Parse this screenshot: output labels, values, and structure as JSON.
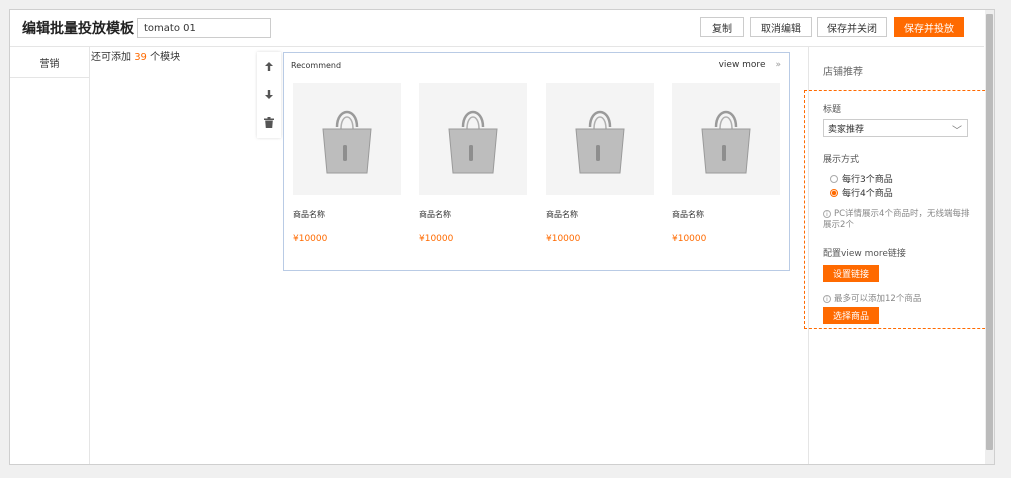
{
  "header": {
    "title": "编辑批量投放模板",
    "name_value": "tomato 01",
    "buttons": {
      "copy": "复制",
      "cancel": "取消编辑",
      "save_close": "保存并关闭",
      "save_publish": "保存并投放"
    }
  },
  "sidebar": {
    "items": [
      {
        "label": "营销"
      }
    ]
  },
  "main": {
    "remaining_prefix": "还可添加",
    "remaining_count": "39",
    "remaining_suffix": "个模块",
    "tools": [
      {
        "icon": "arrow-up-icon"
      },
      {
        "icon": "arrow-down-icon"
      },
      {
        "icon": "trash-icon"
      }
    ],
    "module": {
      "title": "Recommend",
      "view_more": "view more",
      "view_more_icon": "double-chevron-right-icon",
      "products": [
        {
          "name": "商品名称",
          "price": "¥10000"
        },
        {
          "name": "商品名称",
          "price": "¥10000"
        },
        {
          "name": "商品名称",
          "price": "¥10000"
        },
        {
          "name": "商品名称",
          "price": "¥10000"
        }
      ]
    }
  },
  "panel": {
    "title": "店铺推荐",
    "title_label": "标题",
    "title_select": "卖家推荐",
    "display_label": "展示方式",
    "options": [
      {
        "label": "每行3个商品",
        "selected": false
      },
      {
        "label": "每行4个商品",
        "selected": true
      }
    ],
    "display_note": "PC详情展示4个商品时，无线端每排展示2个",
    "link_label": "配置view more链接",
    "set_link_button": "设置链接",
    "max_note": "最多可以添加12个商品",
    "select_goods_button": "选择商品"
  },
  "colors": {
    "accent": "#ff6a00",
    "module_border": "#b9cbe5"
  }
}
